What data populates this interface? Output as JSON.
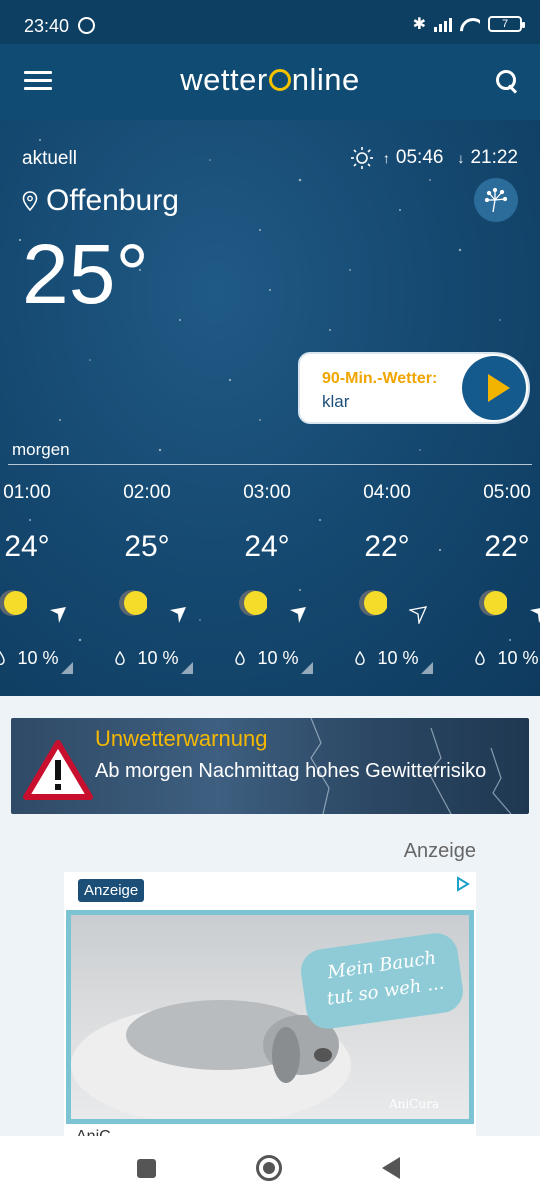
{
  "status_bar": {
    "time": "23:40",
    "battery": "7"
  },
  "app_bar": {
    "logo_left": "wetter",
    "logo_right": "nline"
  },
  "current": {
    "label": "aktuell",
    "sunrise": "05:46",
    "sunset": "21:22",
    "location": "Offenburg",
    "temperature": "25°"
  },
  "nowcast": {
    "title": "90-Min.-Wetter:",
    "value": "klar"
  },
  "forecast": {
    "day_label": "morgen",
    "hours": [
      {
        "time": "01:00",
        "temp": "24°",
        "rain": "10 %"
      },
      {
        "time": "02:00",
        "temp": "25°",
        "rain": "10 %"
      },
      {
        "time": "03:00",
        "temp": "24°",
        "rain": "10 %"
      },
      {
        "time": "04:00",
        "temp": "22°",
        "rain": "10 %"
      },
      {
        "time": "05:00",
        "temp": "22°",
        "rain": "10 %"
      }
    ]
  },
  "warning": {
    "title": "Unwetterwarnung",
    "text": "Ab morgen Nachmittag hohes Gewitterrisiko"
  },
  "ad": {
    "section_label": "Anzeige",
    "badge": "Anzeige",
    "bubble_text": "Mein Bauch tut so weh ...",
    "brand": "AniCura",
    "below_text": "AniC..."
  },
  "colors": {
    "accent_yellow": "#f2b400",
    "app_bar": "#0f4b72",
    "nowcast_title": "#f0a500"
  },
  "icons": [
    "alarm-icon",
    "bluetooth-icon",
    "signal-icon",
    "wifi-icon",
    "battery-icon",
    "menu-icon",
    "search-icon",
    "sun-icon",
    "location-pin-icon",
    "pollen-icon",
    "play-icon",
    "moon-icon",
    "wind-arrow-icon",
    "rain-drop-icon",
    "warning-triangle-icon",
    "adchoices-icon"
  ]
}
